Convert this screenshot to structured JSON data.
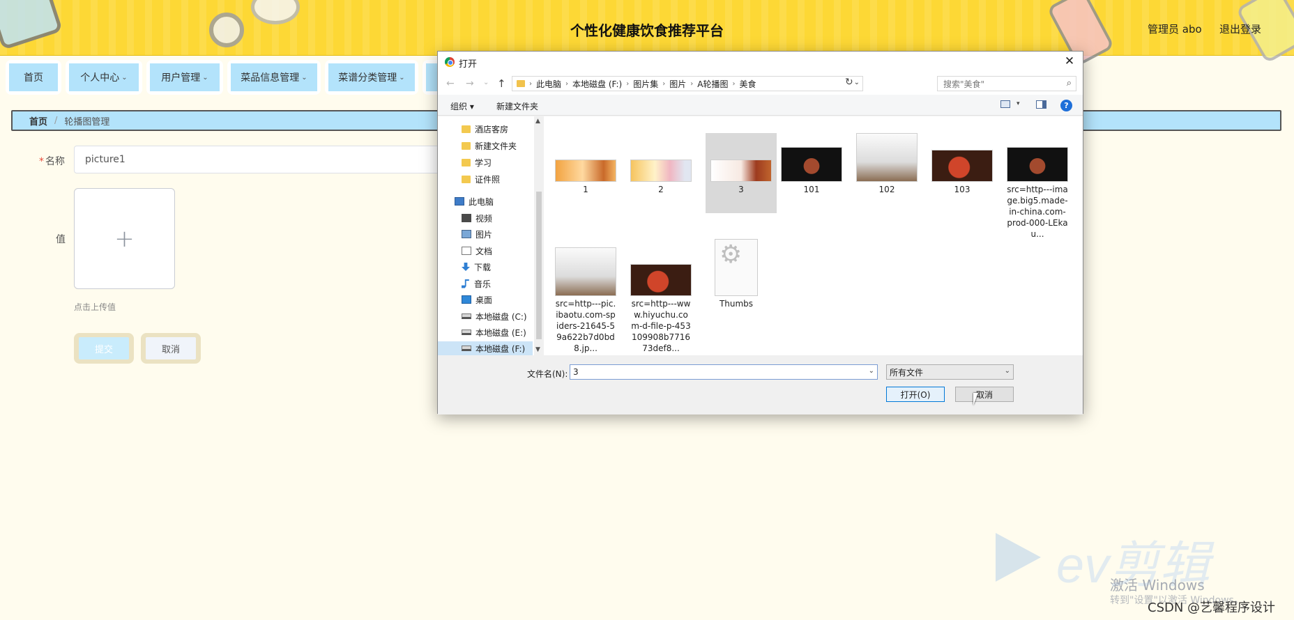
{
  "header": {
    "title": "个性化健康饮食推荐平台",
    "user": "管理员 abo",
    "logout": "退出登录"
  },
  "nav": {
    "items": [
      {
        "label": "首页",
        "chevron": false
      },
      {
        "label": "个人中心",
        "chevron": true
      },
      {
        "label": "用户管理",
        "chevron": true
      },
      {
        "label": "菜品信息管理",
        "chevron": true
      },
      {
        "label": "菜谱分类管理",
        "chevron": true
      }
    ]
  },
  "breadcrumb": {
    "home": "首页",
    "separator": "/",
    "current": "轮播图管理"
  },
  "form": {
    "name_required": "*",
    "name_label": "名称",
    "name_value": "picture1",
    "value_label": "值",
    "upload_plus": "+",
    "upload_tip": "点击上传值",
    "submit": "提交",
    "cancel": "取消"
  },
  "dialog": {
    "title": "打开",
    "close": "✕",
    "nav_back": "←",
    "nav_forward": "→",
    "nav_recent": "⌄",
    "nav_up": "↑",
    "path": [
      "此电脑",
      "本地磁盘 (F:)",
      "图片集",
      "图片",
      "A轮播图",
      "美食"
    ],
    "refresh": "↻",
    "search_placeholder": "搜索\"美食\"",
    "search_icon": "⌕",
    "toolbar_organize": "组织 ▾",
    "toolbar_new_folder": "新建文件夹",
    "help": "?",
    "sidebar": [
      {
        "label": "酒店客房",
        "icon": "folder"
      },
      {
        "label": "新建文件夹",
        "icon": "folder"
      },
      {
        "label": "学习",
        "icon": "folder"
      },
      {
        "label": "证件照",
        "icon": "folder"
      },
      {
        "label": "此电脑",
        "icon": "pc"
      },
      {
        "label": "视频",
        "icon": "video"
      },
      {
        "label": "图片",
        "icon": "pictures"
      },
      {
        "label": "文档",
        "icon": "documents"
      },
      {
        "label": "下载",
        "icon": "download"
      },
      {
        "label": "音乐",
        "icon": "music"
      },
      {
        "label": "桌面",
        "icon": "desktop"
      },
      {
        "label": "本地磁盘 (C:)",
        "icon": "disk"
      },
      {
        "label": "本地磁盘 (E:)",
        "icon": "disk"
      },
      {
        "label": "本地磁盘 (F:)",
        "icon": "disk",
        "selected": true
      }
    ],
    "files": [
      {
        "name": "1",
        "thumb": "orange"
      },
      {
        "name": "2",
        "thumb": "yellow"
      },
      {
        "name": "3",
        "thumb": "red",
        "selected": true
      },
      {
        "name": "101",
        "thumb": "dark"
      },
      {
        "name": "102",
        "thumb": "gray"
      },
      {
        "name": "103",
        "thumb": "hot"
      },
      {
        "name": "src=http---image.big5.made-in-china.com-prod-000-LEkau...",
        "thumb": "dark"
      },
      {
        "name": "src=http---pic.ibaotu.com-spiders-21645-59a622b7d0bd8.jp...",
        "thumb": "gray"
      },
      {
        "name": "src=http---www.hiyuchu.com-d-file-p-453109908b771673def8...",
        "thumb": "hot"
      },
      {
        "name": "Thumbs",
        "thumb": "gear"
      }
    ],
    "filename_label": "文件名(N):",
    "filename_value": "3",
    "filetype_value": "所有文件",
    "open_button": "打开(O)",
    "cancel_button": "取消"
  },
  "watermarks": {
    "ev_text": "ev剪辑",
    "windows_activate": "激活 Windows",
    "windows_hint": "转到\"设置\"以激活 Windows。",
    "csdn": "CSDN @艺馨程序设计"
  }
}
